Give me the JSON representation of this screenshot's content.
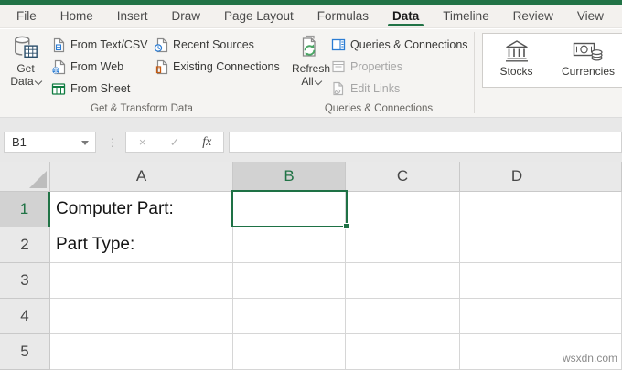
{
  "tabs": {
    "items": [
      "File",
      "Home",
      "Insert",
      "Draw",
      "Page Layout",
      "Formulas",
      "Data",
      "Timeline",
      "Review",
      "View"
    ],
    "active": "Data"
  },
  "ribbon": {
    "get_data": {
      "line1": "Get",
      "line2": "Data"
    },
    "from_text_csv": "From Text/CSV",
    "from_web": "From Web",
    "from_sheet": "From Sheet",
    "recent_sources": "Recent Sources",
    "existing_connections": "Existing Connections",
    "refresh_all": {
      "line1": "Refresh",
      "line2": "All"
    },
    "queries_connections": "Queries & Connections",
    "properties": "Properties",
    "edit_links": "Edit Links",
    "stocks": "Stocks",
    "currencies": "Currencies",
    "group_labels": {
      "get_transform": "Get & Transform Data",
      "queries": "Queries & Connections"
    }
  },
  "formula_bar": {
    "name_box_value": "B1",
    "separator_glyph": "⋮",
    "cancel_glyph": "×",
    "enter_glyph": "✓",
    "fx_glyph": "fx",
    "formula_value": ""
  },
  "sheet": {
    "col_headers": [
      "A",
      "B",
      "C",
      "D",
      ""
    ],
    "row_headers": [
      "1",
      "2",
      "3",
      "4",
      "5"
    ],
    "selected_cell": "B1",
    "cells": {
      "A1": "Computer Part:",
      "A2": "Part Type:"
    }
  },
  "watermark": "wsxdn.com",
  "colors": {
    "accent_green": "#217346",
    "selection_border": "#1e7145",
    "disabled_text": "#a6a6a6",
    "icon_blue": "#2b7cd3",
    "icon_orange": "#c55a11",
    "icon_refresh_green": "#4aa564"
  }
}
